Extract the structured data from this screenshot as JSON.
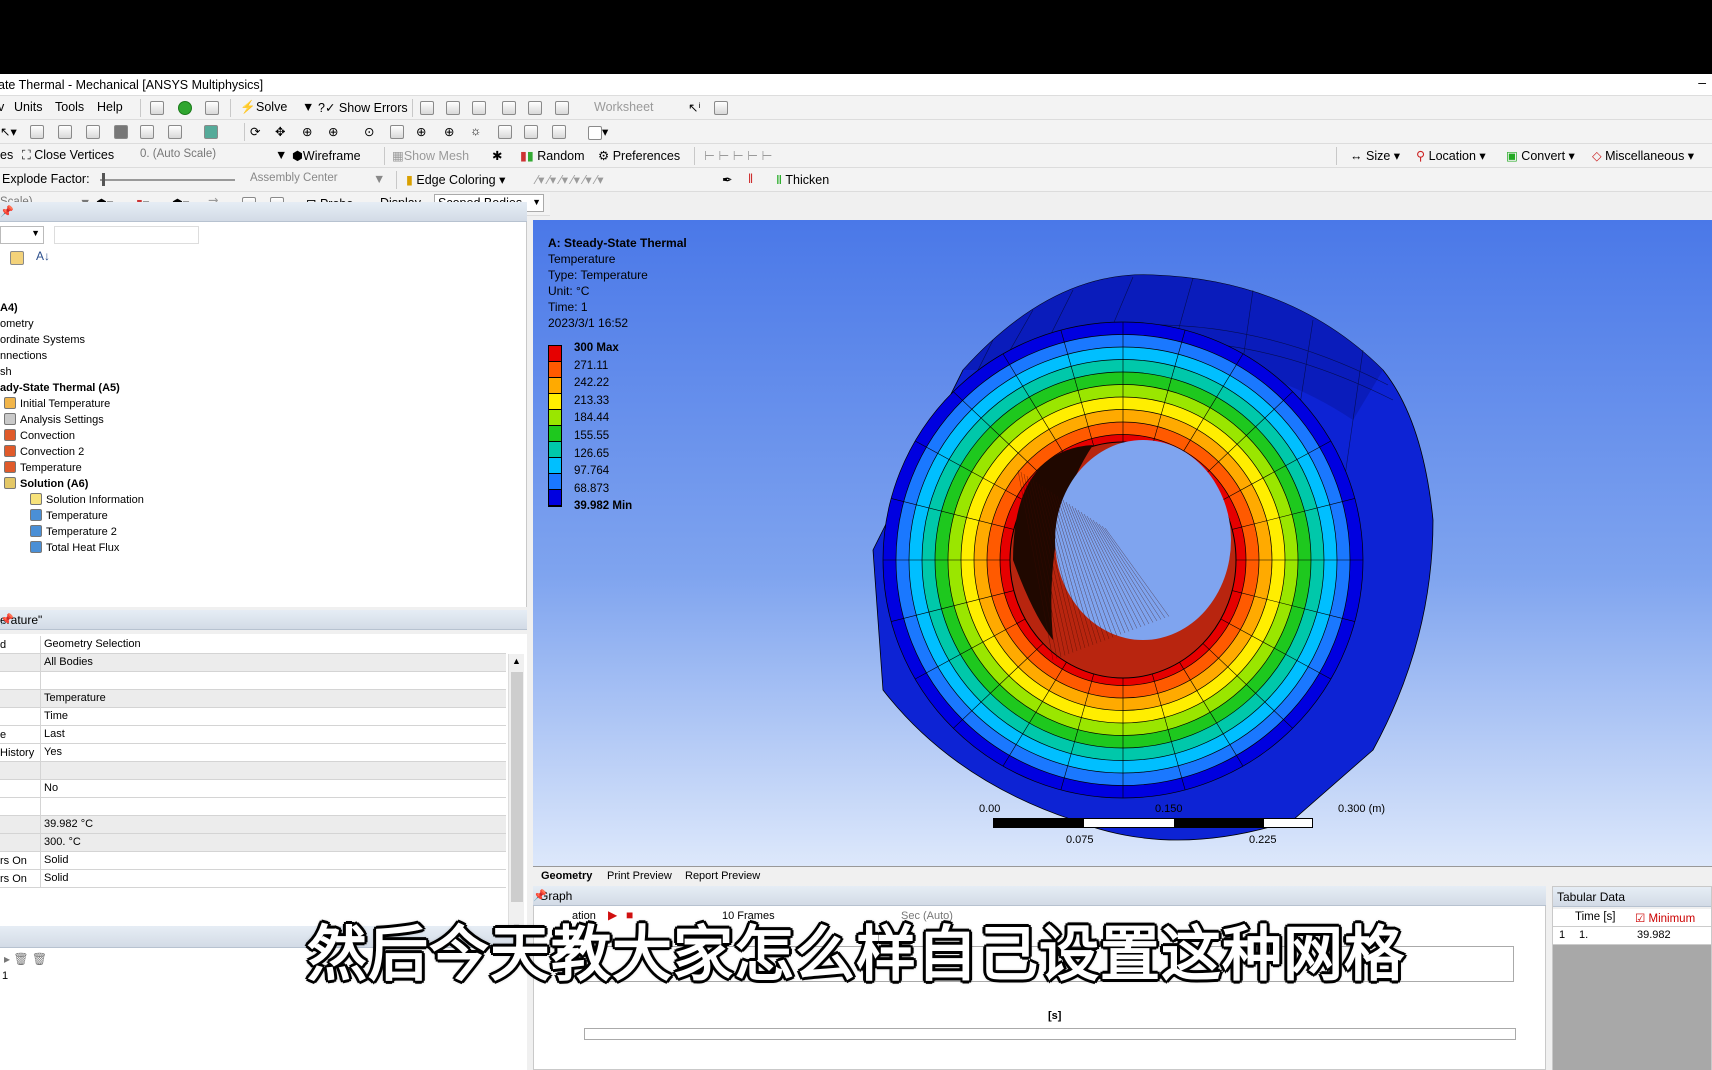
{
  "window_title": "ate Thermal - Mechanical [ANSYS Multiphysics]",
  "menu": {
    "units": "Units",
    "tools": "Tools",
    "help": "Help",
    "solve": "Solve",
    "show_errors": "Show Errors",
    "worksheet": "Worksheet"
  },
  "toolbar3": {
    "close_vertices": "Close Vertices",
    "auto_scale": "0. (Auto Scale)",
    "wireframe": "Wireframe",
    "show_mesh": "Show Mesh",
    "random": "Random",
    "preferences": "Preferences",
    "size": "Size",
    "location": "Location",
    "convert": "Convert",
    "miscellaneous": "Miscellaneous",
    "es": "es"
  },
  "toolbar4": {
    "explode_factor": "Explode Factor:",
    "assembly_center": "Assembly Center",
    "edge_coloring": "Edge Coloring",
    "thicken": "Thicken"
  },
  "toolbar5": {
    "scale": "Scale)",
    "probe": "Probe",
    "display": "Display",
    "scoped_bodies": "Scoped Bodies"
  },
  "tree": [
    {
      "label": "A4)",
      "bold": true,
      "indent": 0
    },
    {
      "label": "ometry",
      "bold": false,
      "indent": 0
    },
    {
      "label": "ordinate Systems",
      "bold": false,
      "indent": 0
    },
    {
      "label": "nnections",
      "bold": false,
      "indent": 0
    },
    {
      "label": "sh",
      "bold": false,
      "indent": 0
    },
    {
      "label": "ady-State Thermal (A5)",
      "bold": true,
      "indent": 0
    },
    {
      "label": "Initial Temperature",
      "bold": false,
      "indent": 1
    },
    {
      "label": "Analysis Settings",
      "bold": false,
      "indent": 1
    },
    {
      "label": "Convection",
      "bold": false,
      "indent": 1
    },
    {
      "label": "Convection 2",
      "bold": false,
      "indent": 1
    },
    {
      "label": "Temperature",
      "bold": false,
      "indent": 1
    },
    {
      "label": "Solution (A6)",
      "bold": true,
      "indent": 1
    },
    {
      "label": "Solution Information",
      "bold": false,
      "indent": 2
    },
    {
      "label": "Temperature",
      "bold": false,
      "indent": 2
    },
    {
      "label": "Temperature 2",
      "bold": false,
      "indent": 2
    },
    {
      "label": "Total Heat Flux",
      "bold": false,
      "indent": 2
    }
  ],
  "details_title": "erature\"",
  "details": [
    {
      "k": "d",
      "v": "Geometry Selection",
      "g": false
    },
    {
      "k": "",
      "v": "All Bodies",
      "g": true
    },
    {
      "k": "",
      "v": "",
      "g": false
    },
    {
      "k": "",
      "v": "Temperature",
      "g": true
    },
    {
      "k": "",
      "v": "Time",
      "g": false
    },
    {
      "k": "e",
      "v": "Last",
      "g": false
    },
    {
      "k": "History",
      "v": "Yes",
      "g": false
    },
    {
      "k": "",
      "v": "",
      "g": true
    },
    {
      "k": "",
      "v": "No",
      "g": false
    },
    {
      "k": "",
      "v": "",
      "g": false
    },
    {
      "k": "",
      "v": "39.982 °C",
      "g": true
    },
    {
      "k": "",
      "v": "300. °C",
      "g": true
    },
    {
      "k": "rs On",
      "v": "Solid",
      "g": false
    },
    {
      "k": "rs On",
      "v": "Solid",
      "g": false
    }
  ],
  "bottom_left_value": "1",
  "viewport": {
    "title": "A: Steady-State Thermal",
    "l1": "Temperature",
    "l2": "Type: Temperature",
    "l3": "Unit: °C",
    "l4": "Time: 1",
    "l5": "2023/3/1 16:52"
  },
  "legend": [
    {
      "label": "300 Max",
      "color": "#e60000",
      "bold": true
    },
    {
      "label": "271.11",
      "color": "#ff5a00",
      "bold": false
    },
    {
      "label": "242.22",
      "color": "#ffaa00",
      "bold": false
    },
    {
      "label": "213.33",
      "color": "#ffee00",
      "bold": false
    },
    {
      "label": "184.44",
      "color": "#9ae600",
      "bold": false
    },
    {
      "label": "155.55",
      "color": "#1ec81e",
      "bold": false
    },
    {
      "label": "126.65",
      "color": "#00c8aa",
      "bold": false
    },
    {
      "label": "97.764",
      "color": "#00bfff",
      "bold": false
    },
    {
      "label": "68.873",
      "color": "#1a78ff",
      "bold": false
    },
    {
      "label": "39.982 Min",
      "color": "#0000e0",
      "bold": true
    }
  ],
  "scale": {
    "a": "0.00",
    "b": "0.150",
    "c": "0.300 (m)",
    "d": "0.075",
    "e": "0.225"
  },
  "tabs": {
    "geometry": "Geometry",
    "print": "Print Preview",
    "report": "Report Preview"
  },
  "graph": {
    "title": "Graph",
    "animation": "ation",
    "frames": "10 Frames",
    "sec": "Sec (Auto)",
    "xlabel": "[s]"
  },
  "tabular": {
    "title": "Tabular Data",
    "col_time": "Time [s]",
    "col_min": "Minimum",
    "row": "1",
    "time": "1.",
    "min": "39.982"
  },
  "subtitle": "然后今天教大家怎么样自己设置这种网格"
}
